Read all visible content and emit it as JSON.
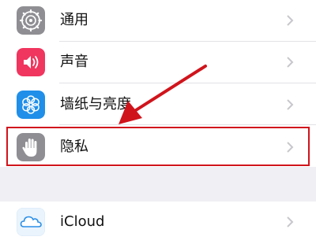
{
  "settings": {
    "items": [
      {
        "label": "通用",
        "icon": "gear-icon",
        "icon_color": "#8e8e93"
      },
      {
        "label": "声音",
        "icon": "speaker-icon",
        "icon_color": "#f0355e"
      },
      {
        "label": "墙纸与亮度",
        "icon": "flower-icon",
        "icon_color": "#1f8fe9"
      },
      {
        "label": "隐私",
        "icon": "hand-icon",
        "icon_color": "#8e8e93"
      },
      {
        "label": "iCloud",
        "icon": "cloud-icon",
        "icon_color": "#e8f3fd"
      }
    ]
  },
  "annotation": {
    "highlight_color": "#d0141c",
    "arrow_color": "#d0141c",
    "highlighted_item": "隐私"
  }
}
